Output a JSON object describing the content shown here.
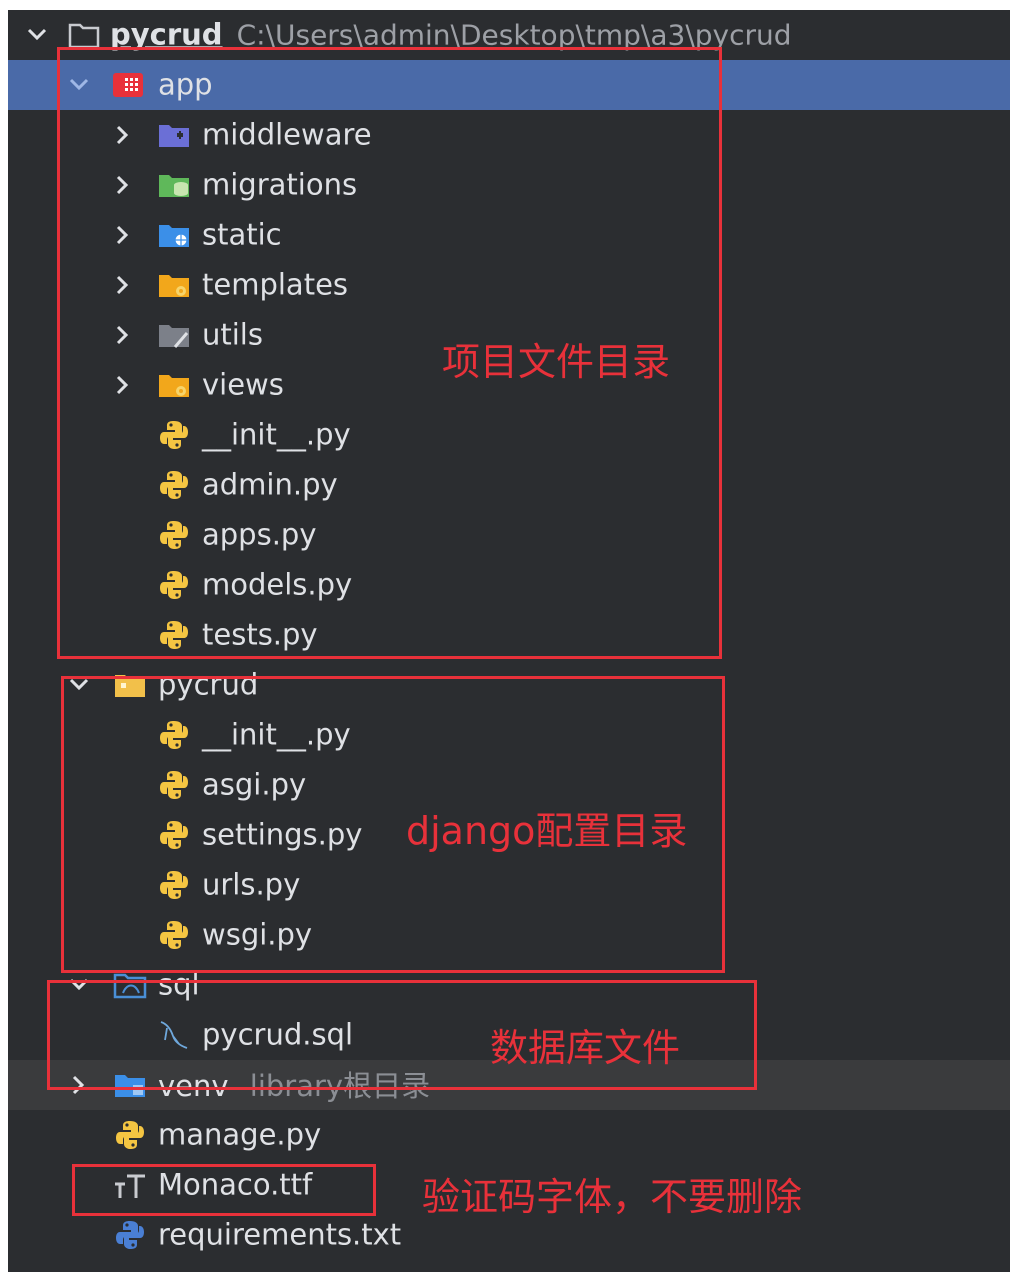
{
  "project": {
    "name": "pycrud",
    "path": "C:\\Users\\admin\\Desktop\\tmp\\a3\\pycrud"
  },
  "tree": {
    "app": "app",
    "middleware": "middleware",
    "migrations": "migrations",
    "static": "static",
    "templates": "templates",
    "utils": "utils",
    "views": "views",
    "app_init": "__init__.py",
    "admin": "admin.py",
    "apps": "apps.py",
    "models": "models.py",
    "tests": "tests.py",
    "pycrud_dir": "pycrud",
    "pycrud_init": "__init__.py",
    "asgi": "asgi.py",
    "settings": "settings.py",
    "urls": "urls.py",
    "wsgi": "wsgi.py",
    "sql": "sql",
    "pycrud_sql": "pycrud.sql",
    "venv": "venv",
    "venv_suffix": "library根目录",
    "manage": "manage.py",
    "monaco": "Monaco.ttf",
    "requirements": "requirements.txt"
  },
  "annotations": {
    "project_dir": "项目文件目录",
    "django_config": "django配置目录",
    "database_files": "数据库文件",
    "captcha_font": "验证码字体，不要删除"
  },
  "colors": {
    "panel_bg": "#2b2d30",
    "selection": "#4a6aa8",
    "annotation_red": "#e8313a",
    "python_yellow": "#f4c542",
    "python_blue": "#4a7fd4"
  }
}
